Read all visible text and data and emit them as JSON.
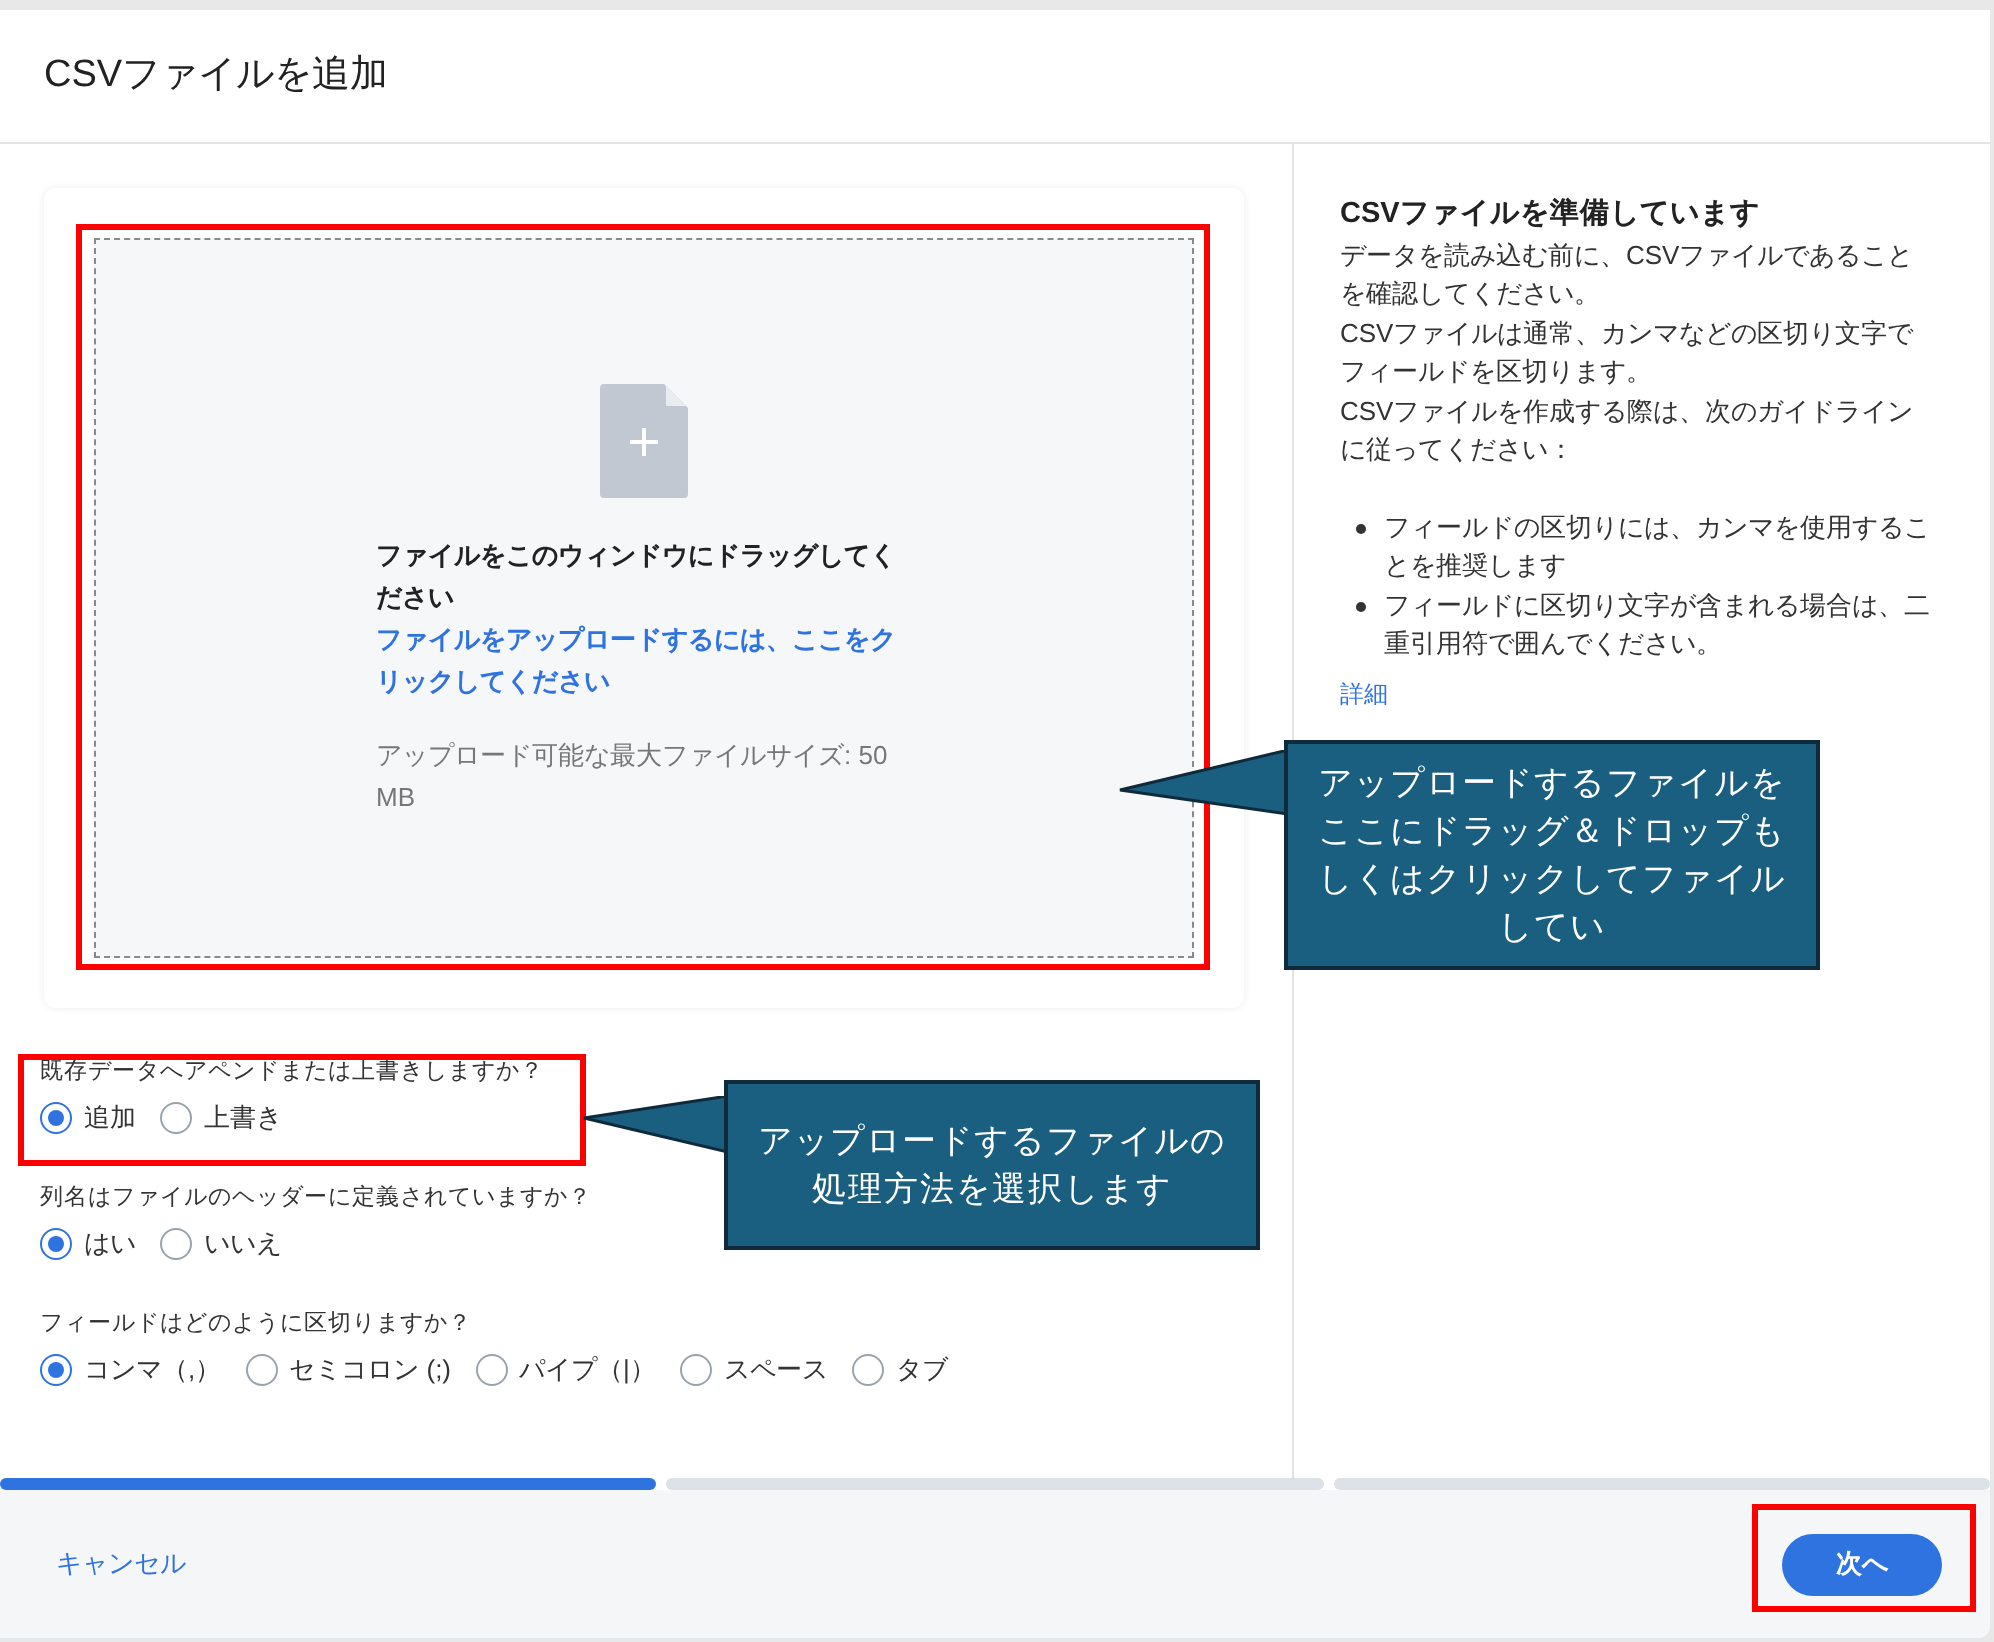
{
  "dialog": {
    "title": "CSVファイルを追加"
  },
  "drop_zone": {
    "instruction": "ファイルをこのウィンドウにドラッグしてください",
    "upload_link": "ファイルをアップロードするには、ここをクリックしてください",
    "size_limit": "アップロード可能な最大ファイルサイズ: 50 MB"
  },
  "questions": [
    {
      "label": "既存データへアペンドまたは上書きしますか？",
      "options": [
        {
          "label": "追加",
          "selected": true
        },
        {
          "label": "上書き",
          "selected": false
        }
      ]
    },
    {
      "label": "列名はファイルのヘッダーに定義されていますか？",
      "options": [
        {
          "label": "はい",
          "selected": true
        },
        {
          "label": "いいえ",
          "selected": false
        }
      ]
    },
    {
      "label": "フィールドはどのように区切りますか？",
      "options": [
        {
          "label": "コンマ（,）",
          "selected": true
        },
        {
          "label": "セミコロン (;)",
          "selected": false
        },
        {
          "label": "パイプ（|）",
          "selected": false
        },
        {
          "label": "スペース",
          "selected": false
        },
        {
          "label": "タブ",
          "selected": false
        }
      ]
    }
  ],
  "help": {
    "title": "CSVファイルを準備しています",
    "paragraphs": [
      "データを読み込む前に、CSVファイルであることを確認してください。",
      "CSVファイルは通常、カンマなどの区切り文字でフィールドを区切ります。",
      "CSVファイルを作成する際は、次のガイドラインに従ってください："
    ],
    "bullets": [
      "フィールドの区切りには、カンマを使用することを推奨します",
      "フィールドに区切り文字が含まれる場合は、二重引用符で囲んでください。"
    ],
    "link": "詳細"
  },
  "progress": [
    {
      "selected": true
    },
    {
      "selected": false
    },
    {
      "selected": false
    }
  ],
  "footer": {
    "cancel": "キャンセル",
    "next": "次へ"
  },
  "callouts": [
    "アップロードするファイルをここにドラッグ＆ドロップもしくはクリックしてファイルしてい",
    "アップロードするファイルの処理方法を選択します"
  ]
}
